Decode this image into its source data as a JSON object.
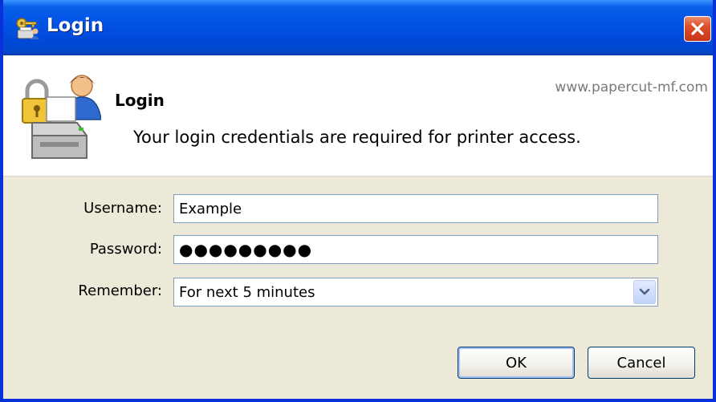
{
  "window": {
    "title": "Login"
  },
  "header": {
    "title": "Login",
    "url": "www.papercut-mf.com",
    "description": "Your login credentials are required for printer access."
  },
  "form": {
    "username": {
      "label": "Username:",
      "value": "Example"
    },
    "password": {
      "label": "Password:",
      "masked": "●●●●●●●●●"
    },
    "remember": {
      "label": "Remember:",
      "selected": "For next 5 minutes"
    }
  },
  "buttons": {
    "ok": "OK",
    "cancel": "Cancel"
  },
  "colors": {
    "titlebar": "#0254e5",
    "close": "#dd4f2a",
    "dialog_bg": "#ece9d8",
    "frame": "#0831d9"
  },
  "icons": {
    "title": "login-key-icon",
    "header": "printer-lock-user-icon",
    "close": "close-icon",
    "dropdown": "chevron-down-icon"
  }
}
